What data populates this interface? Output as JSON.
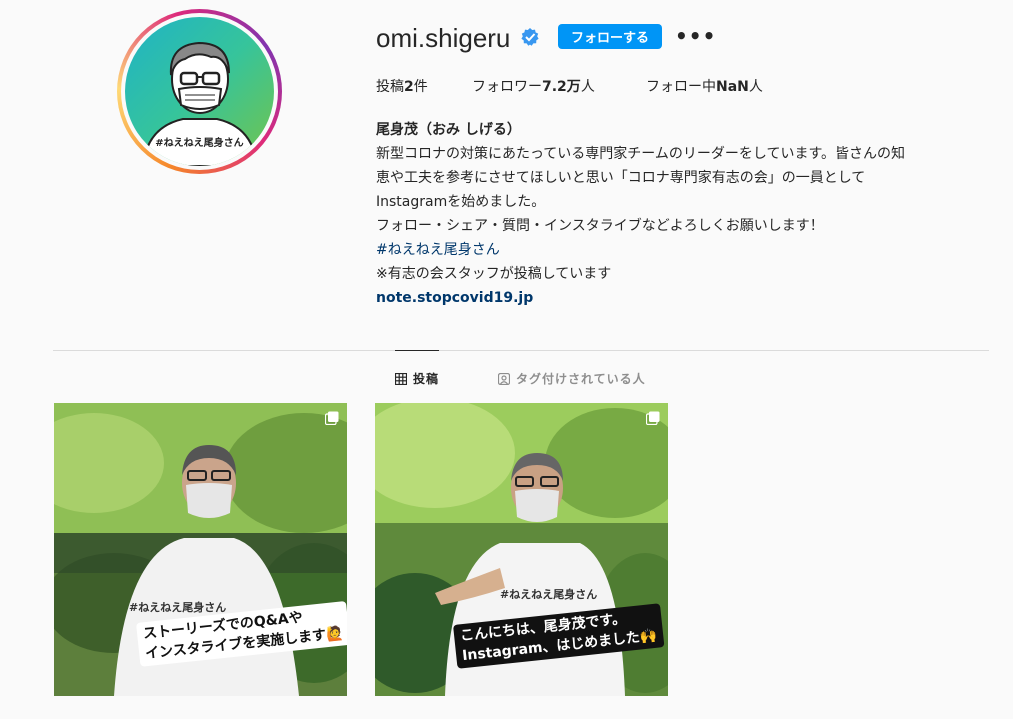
{
  "profile": {
    "avatar_caption": "#ねえねえ尾身さん",
    "username": "omi.shigeru",
    "follow_label": "フォローする",
    "more_label": "•••"
  },
  "stats": {
    "posts_label": "投稿",
    "posts_value": "2",
    "posts_unit": "件",
    "followers_label": "フォロワー",
    "followers_value": "7.2万",
    "followers_unit": "人",
    "following_label": "フォロー中",
    "following_value": "NaN",
    "following_unit": "人"
  },
  "bio": {
    "name": "尾身茂（おみ しげる）",
    "line1": "新型コロナの対策にあたっている専門家チームのリーダーをしています。皆さんの知",
    "line2": "恵や工夫を参考にさせてほしいと思い「コロナ専門家有志の会」の一員として",
    "line3": "Instagramを始めました。",
    "line4": "フォロー・シェア・質問・インスタライブなどよろしくお願いします！",
    "hashtag": "#ねえねえ尾身さん",
    "line5": "※有志の会スタッフが投稿しています",
    "link": "note.stopcovid19.jp"
  },
  "tabs": {
    "posts": "投稿",
    "tagged": "タグ付けされている人"
  },
  "posts": [
    {
      "caption_line1": "ストーリーズでのQ&Aや",
      "caption_line2": "インスタライブを実施します🙋",
      "shirt_text": "#ねえねえ尾身さん"
    },
    {
      "caption_line1": "こんにちは、尾身茂です。",
      "caption_line2": "Instagram、はじめました🙌",
      "shirt_text": "#ねえねえ尾身さん"
    }
  ],
  "colors": {
    "accent": "#0095f6",
    "link": "#00376b",
    "verified": "#3897f0",
    "divider": "#dbdbdb"
  },
  "icons": [
    "verified-badge-icon",
    "more-options-icon",
    "grid-icon",
    "tagged-person-icon",
    "multiple-posts-icon"
  ]
}
